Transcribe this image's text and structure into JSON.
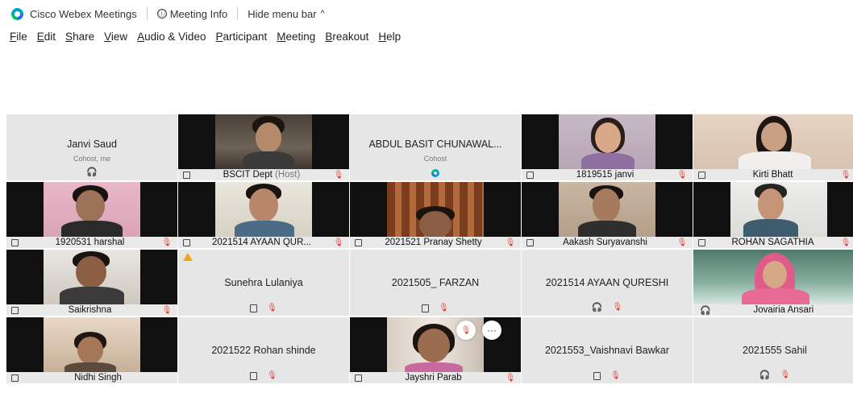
{
  "titlebar": {
    "app_name": "Cisco Webex Meetings",
    "meeting_info": "Meeting Info",
    "info_glyph": "ⓘ",
    "hide_menu": "Hide menu bar",
    "caret": "^"
  },
  "menu": [
    {
      "u": "F",
      "rest": "ile"
    },
    {
      "u": "E",
      "rest": "dit"
    },
    {
      "u": "S",
      "rest": "hare"
    },
    {
      "u": "V",
      "rest": "iew"
    },
    {
      "u": "A",
      "rest": "udio & Video"
    },
    {
      "u": "P",
      "rest": "articipant"
    },
    {
      "u": "M",
      "rest": "eeting"
    },
    {
      "u": "B",
      "rest": "reakout"
    },
    {
      "u": "H",
      "rest": "elp"
    }
  ],
  "icons": {
    "mute": "🎙",
    "headset": "🎧",
    "more": "···"
  },
  "tiles": {
    "t1": {
      "name": "Janvi Saud",
      "sub": "Cohost, me"
    },
    "t2": {
      "name": "BSCIT Dept",
      "role": "(Host)"
    },
    "t3": {
      "name": "ABDUL BASIT CHUNAWAL...",
      "sub": "Cohost"
    },
    "t4": {
      "name": "1819515 janvi"
    },
    "t5": {
      "name": "Kirti Bhatt"
    },
    "t6": {
      "name": "1920531 harshal"
    },
    "t7": {
      "name": "2021514 AYAAN QUR..."
    },
    "t8": {
      "name": "2021521 Pranay Shetty"
    },
    "t9": {
      "name": "Aakash Suryavanshi"
    },
    "t10": {
      "name": "ROHAN SAGATHIA"
    },
    "t11": {
      "name": "Saikrishna"
    },
    "t12": {
      "name": "Sunehra Lulaniya"
    },
    "t13": {
      "name": "2021505_ FARZAN"
    },
    "t14": {
      "name": "2021514 AYAAN QURESHI"
    },
    "t15": {
      "name": "Jovairia Ansari"
    },
    "t16": {
      "name": "Nidhi Singh"
    },
    "t17": {
      "name": "2021522 Rohan shinde"
    },
    "t18": {
      "name": "Jayshri Parab"
    },
    "t19": {
      "name": "2021553_Vaishnavi Bawkar"
    },
    "t20": {
      "name": "2021555 Sahil"
    }
  }
}
